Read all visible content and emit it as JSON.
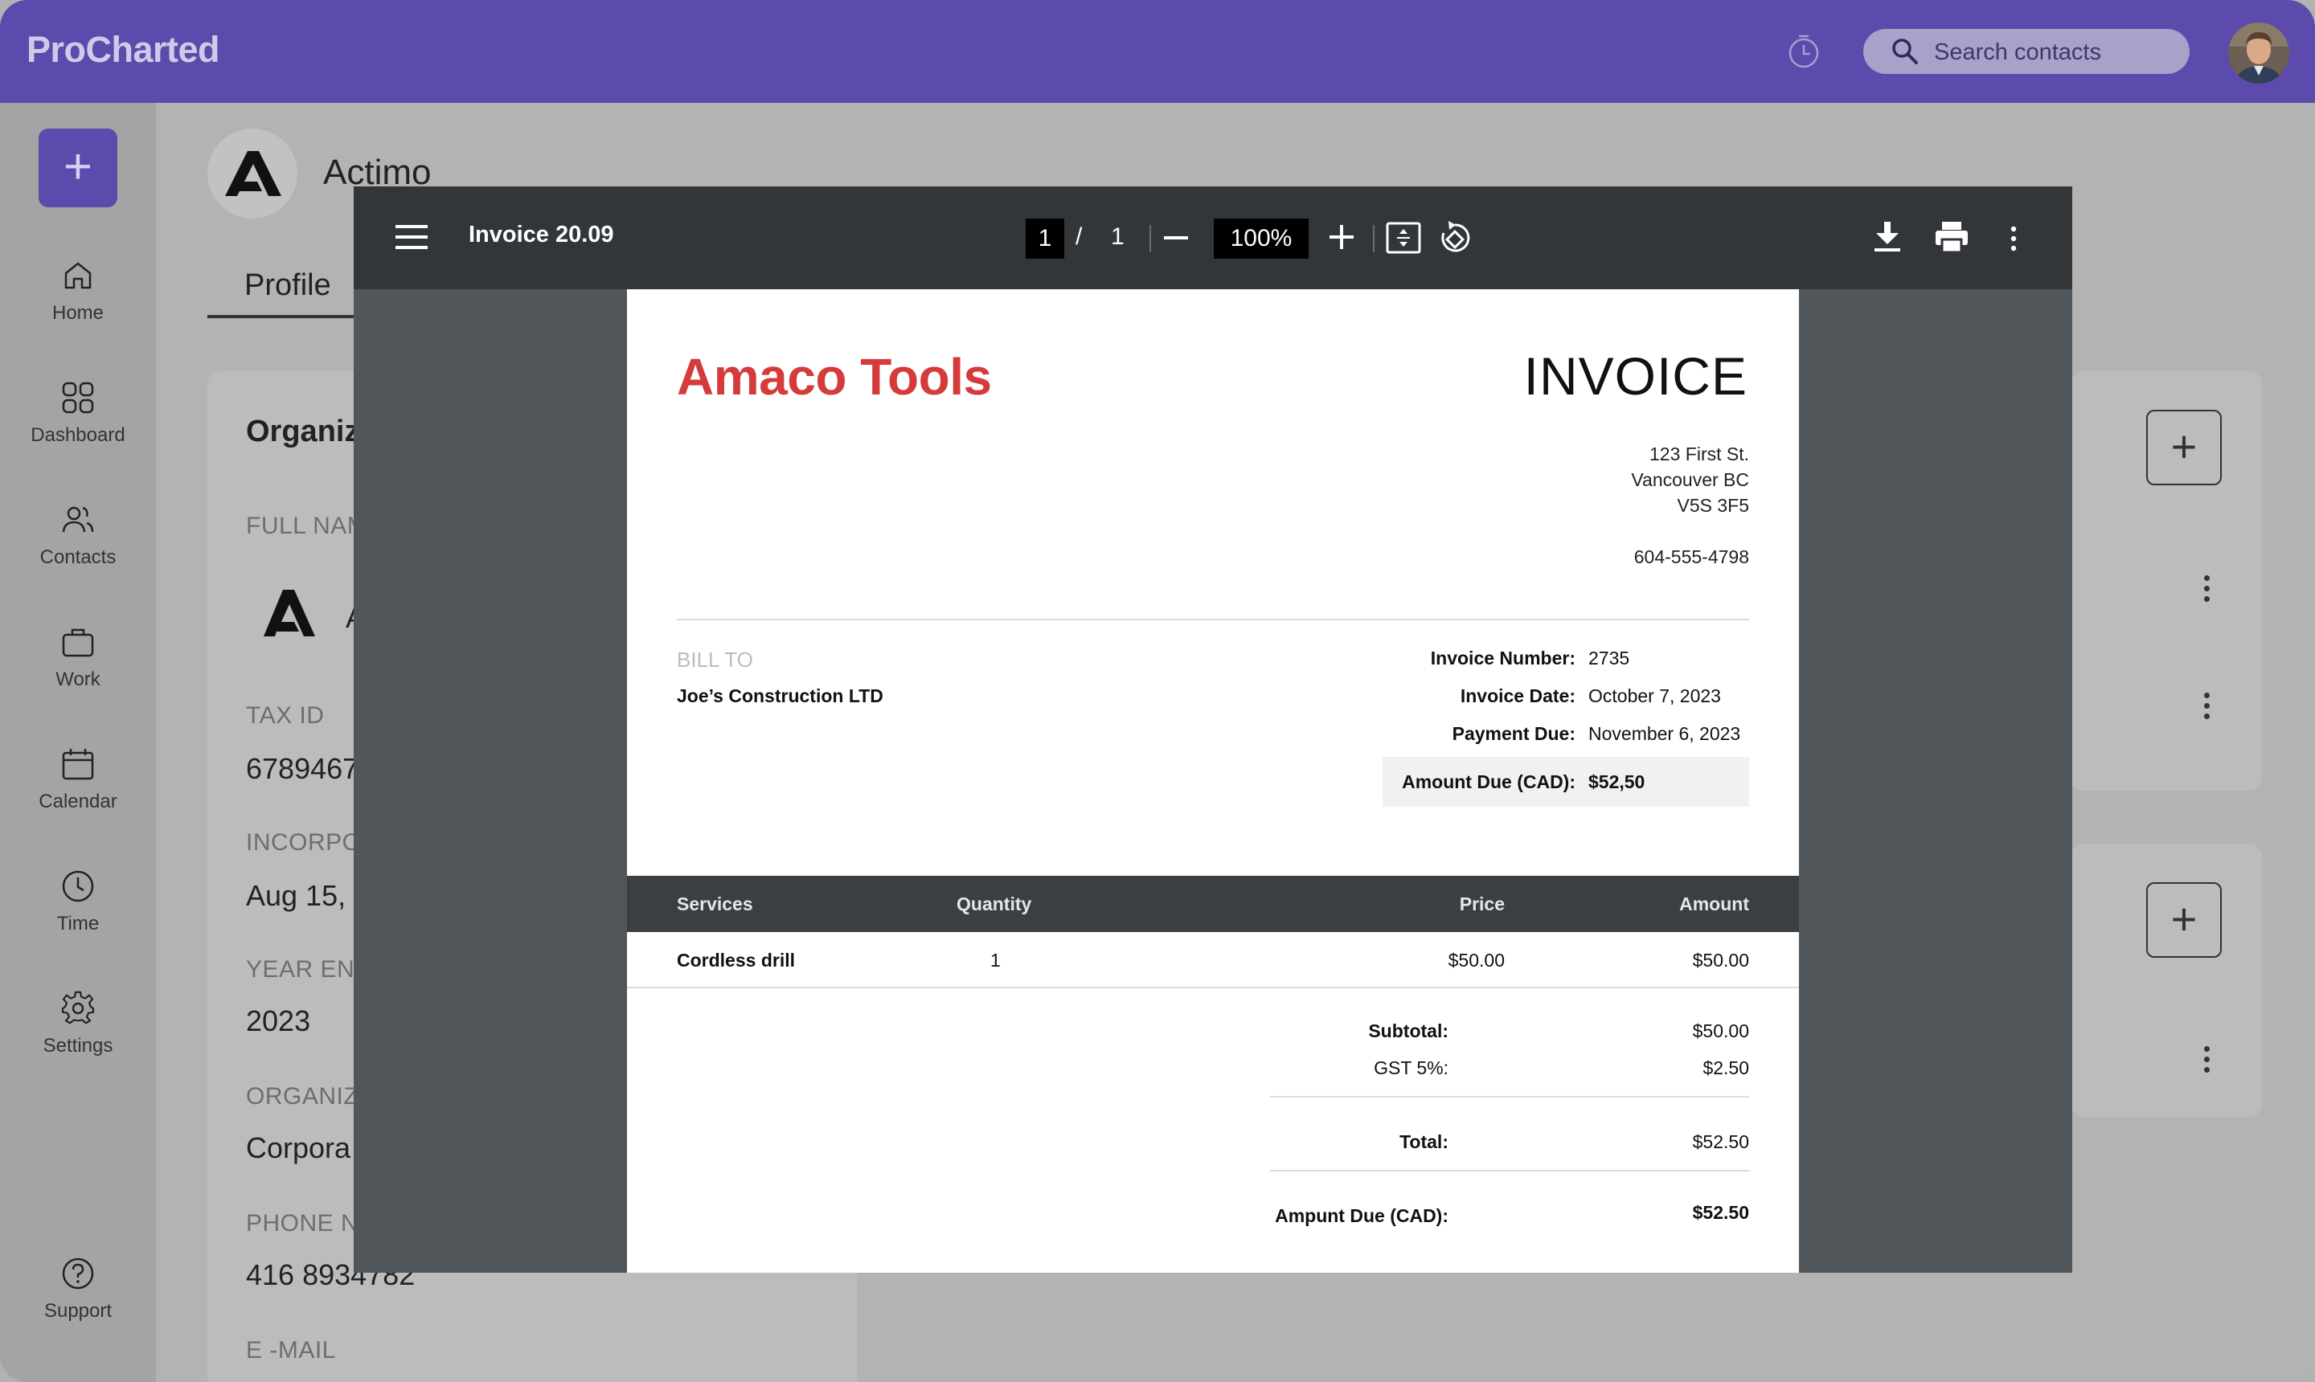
{
  "app": {
    "brand": "ProCharted",
    "search_placeholder": "Search contacts"
  },
  "sidebar": {
    "items": [
      {
        "label": "Home"
      },
      {
        "label": "Dashboard"
      },
      {
        "label": "Contacts"
      },
      {
        "label": "Work"
      },
      {
        "label": "Calendar"
      },
      {
        "label": "Time"
      },
      {
        "label": "Settings"
      }
    ],
    "support": "Support"
  },
  "organization": {
    "name": "Actimo",
    "tab": "Profile",
    "card_title": "Organiz",
    "fields": [
      {
        "label": "FULL NAM",
        "value": ""
      },
      {
        "label": "TAX ID",
        "value": "6789467"
      },
      {
        "label": "INCORPO",
        "value": "Aug 15, 2"
      },
      {
        "label": "YEAR END",
        "value": "2023"
      },
      {
        "label": "ORGANIZ",
        "value": "Corpora"
      },
      {
        "label": "PHONE N",
        "value": "416 8934782"
      },
      {
        "label": "E -MAIL",
        "value": ""
      }
    ],
    "full_name_initial": "A"
  },
  "viewer": {
    "title": "Invoice 20.09",
    "page_current": "1",
    "page_separator": "/",
    "page_total": "1",
    "zoom": "100%"
  },
  "invoice": {
    "company": "Amaco Tools",
    "title": "INVOICE",
    "address": [
      "123 First St.",
      "Vancouver BC",
      "V5S 3F5"
    ],
    "phone": "604-555-4798",
    "bill_to_label": "BILL TO",
    "bill_to": "Joe’s Construction LTD",
    "meta": [
      {
        "label": "Invoice Number:",
        "value": "2735"
      },
      {
        "label": "Invoice Date:",
        "value": "October 7, 2023"
      },
      {
        "label": "Payment Due:",
        "value": "November 6, 2023"
      },
      {
        "label": "Amount Due (CAD):",
        "value": "$52,50"
      }
    ],
    "columns": {
      "services": "Services",
      "quantity": "Quantity",
      "price": "Price",
      "amount": "Amount"
    },
    "rows": [
      {
        "service": "Cordless drill",
        "quantity": "1",
        "price": "$50.00",
        "amount": "$50.00"
      }
    ],
    "totals": {
      "subtotal_label": "Subtotal:",
      "subtotal": "$50.00",
      "gst_label": "GST 5%:",
      "gst": "$2.50",
      "total_label": "Total:",
      "total": "$52.50",
      "due_label": "Ampunt Due (CAD):",
      "due": "$52.50"
    }
  }
}
